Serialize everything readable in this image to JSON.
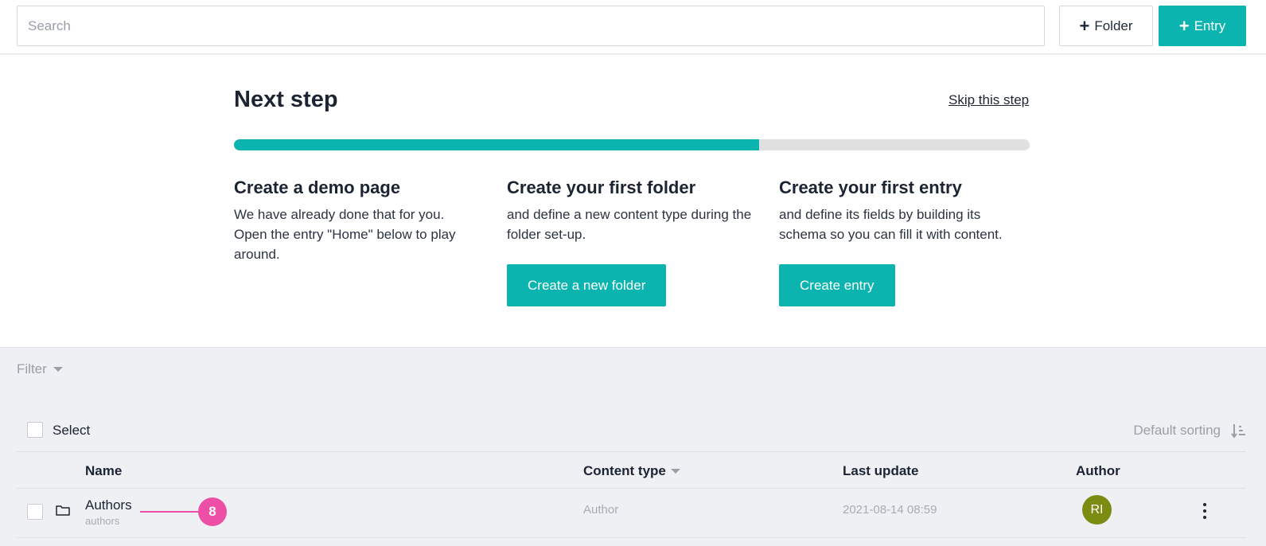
{
  "toolbar": {
    "search_placeholder": "Search",
    "folder_button": "Folder",
    "entry_button": "Entry",
    "accent_color": "#0bb4ae"
  },
  "onboarding": {
    "title": "Next step",
    "skip_link": "Skip this step",
    "progress_fraction": 0.66,
    "steps": [
      {
        "title": "Create a demo page",
        "description": "We have already done that for you. Open the entry \"Home\" below to play around."
      },
      {
        "title": "Create your first folder",
        "description": "and define a new content type during the folder set-up.",
        "button": "Create a new folder"
      },
      {
        "title": "Create your first entry",
        "description": "and define its fields by building its schema so you can fill it with content.",
        "button": "Create entry"
      }
    ]
  },
  "filter": {
    "label": "Filter"
  },
  "list": {
    "select_label": "Select",
    "sorting_label": "Default sorting",
    "columns": {
      "name": "Name",
      "content_type": "Content type",
      "last_update": "Last update",
      "author": "Author"
    },
    "rows": [
      {
        "name": "Authors",
        "slug": "authors",
        "content_type": "Author",
        "last_update": "2021-08-14 08:59",
        "author_initials": "RI",
        "icon": "folder-icon"
      }
    ]
  },
  "annotation": {
    "number": "8",
    "color": "#ee4fa6"
  }
}
